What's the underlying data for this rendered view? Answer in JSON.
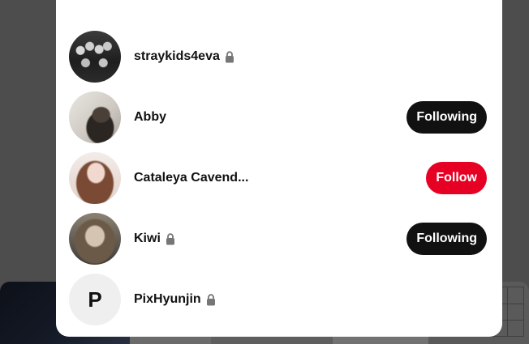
{
  "colors": {
    "overlay": "#4d4d4d",
    "modal_bg": "#ffffff",
    "following_button": "#111111",
    "follow_button": "#e60023",
    "lock_icon": "#767676"
  },
  "users": [
    {
      "name": "straykids4eva",
      "private": true,
      "avatar_icon": "avatar-photo",
      "button": null
    },
    {
      "name": "Abby",
      "private": false,
      "avatar_icon": "avatar-photo",
      "button": "Following"
    },
    {
      "name": "Cataleya Cavend...",
      "private": false,
      "avatar_icon": "avatar-photo",
      "button": "Follow"
    },
    {
      "name": "Kiwi",
      "private": true,
      "avatar_icon": "avatar-photo",
      "button": "Following"
    },
    {
      "name": "PixHyunjin",
      "private": true,
      "avatar_icon": "avatar-initial",
      "avatar_initial": "P",
      "button": null
    }
  ]
}
